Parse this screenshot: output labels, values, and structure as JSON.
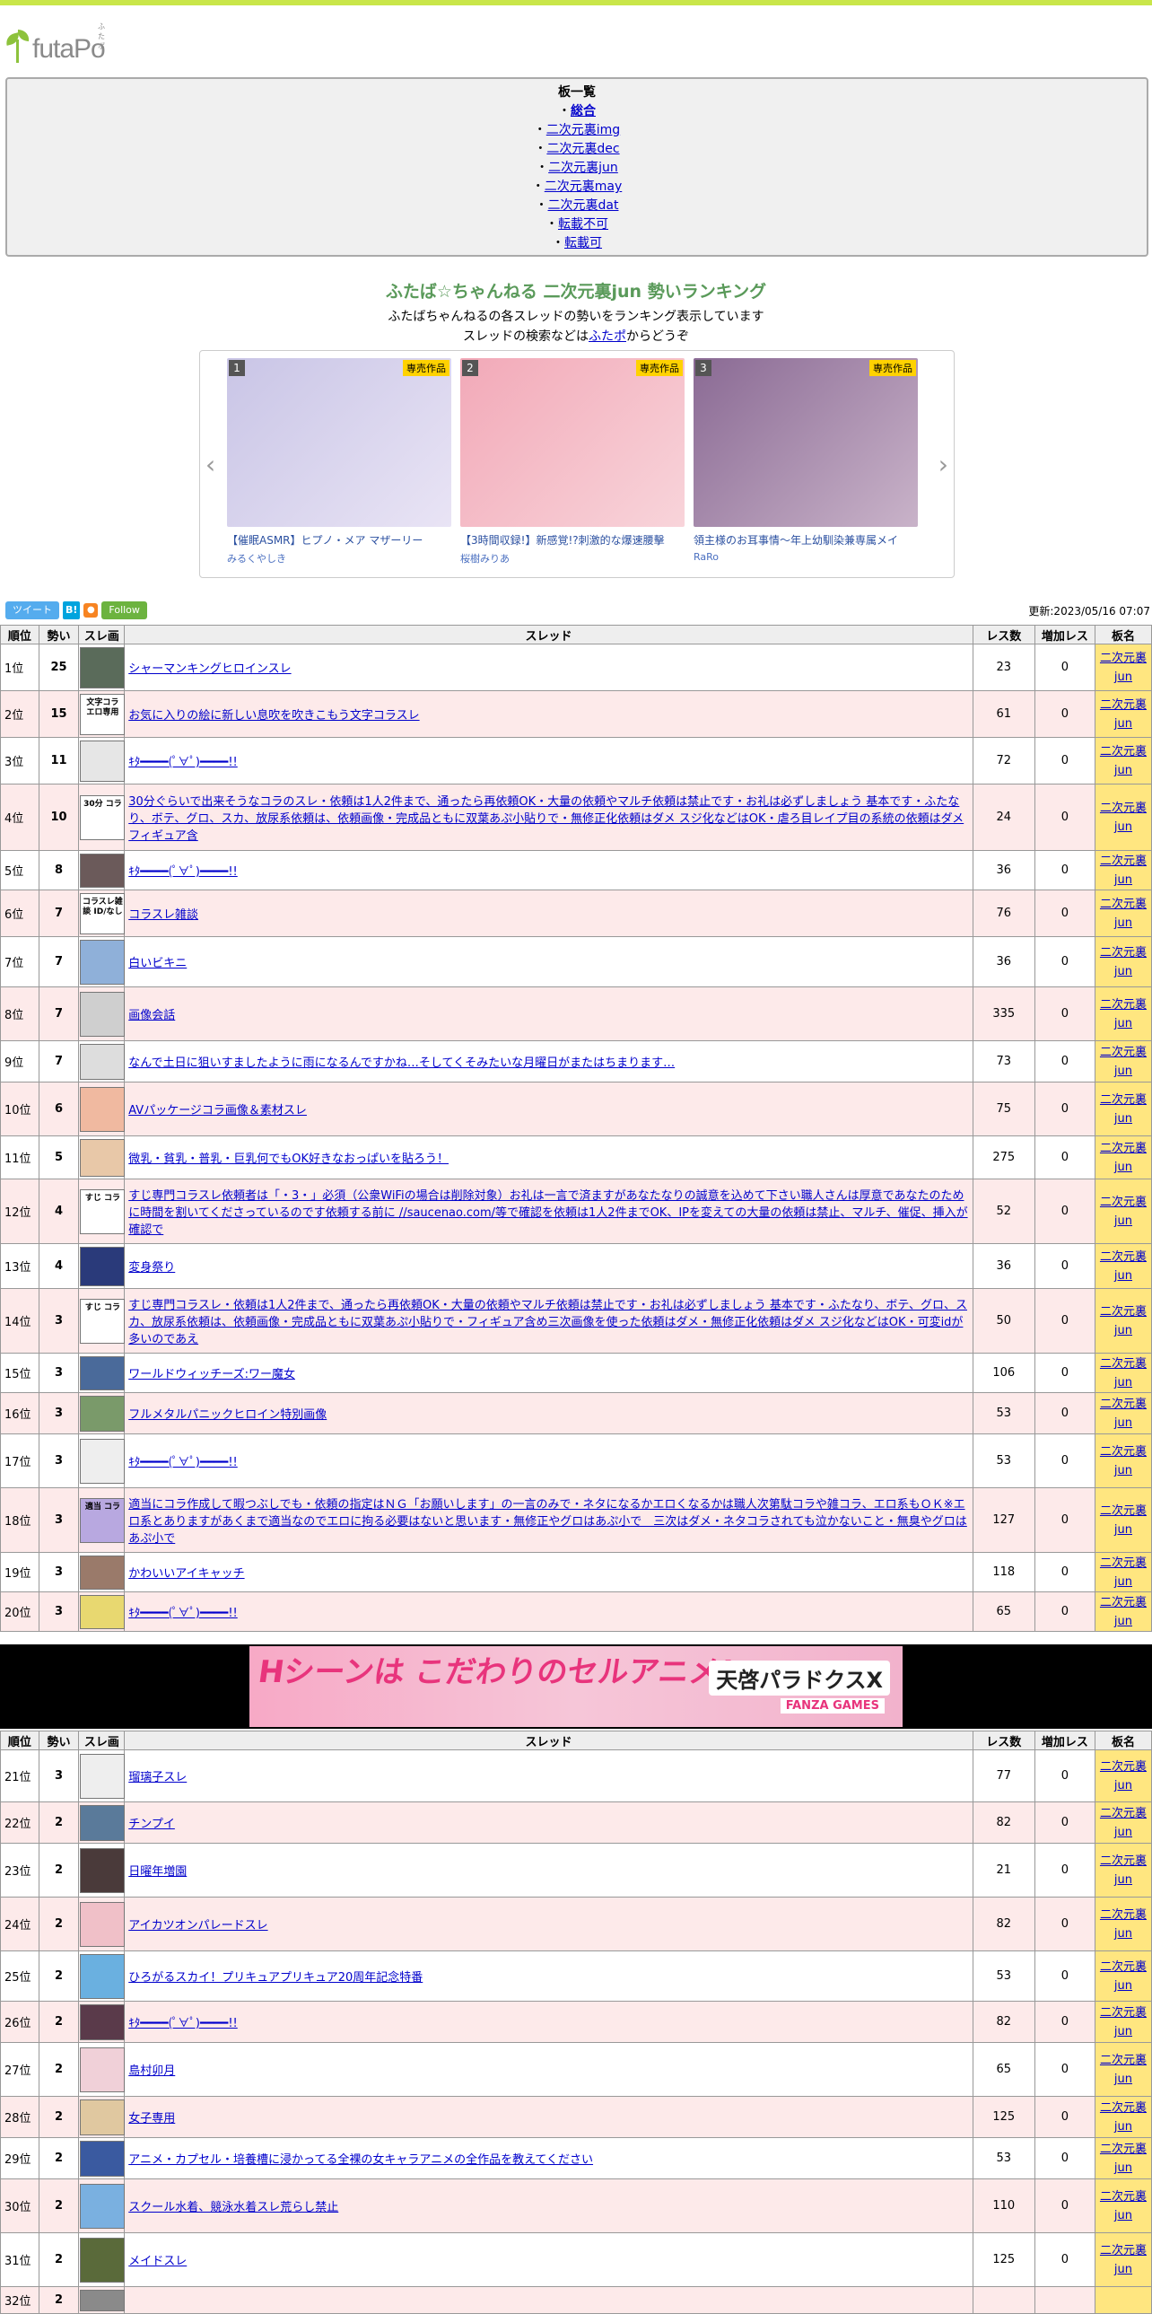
{
  "site": {
    "logo_text": "futaPo",
    "logo_ruby": "ふたポ"
  },
  "boards": {
    "heading": "板一覧",
    "items": [
      "総合",
      "二次元裏img",
      "二次元裏dec",
      "二次元裏jun",
      "二次元裏may",
      "二次元裏dat",
      "転載不可",
      "転載可"
    ]
  },
  "page": {
    "title": "ふたば☆ちゃんねる 二次元裏jun 勢いランキング",
    "desc1": "ふたばちゃんねるの各スレッドの勢いをランキング表示しています",
    "desc2_pre": "スレッドの検索などは",
    "desc2_link": "ふたポ",
    "desc2_post": "からどうぞ",
    "updated": "更新:2023/05/16 07:07"
  },
  "carousel": {
    "cards": [
      {
        "num": "1",
        "badge": "専売作品",
        "title": "【催眠ASMR】ヒプノ・メア マザーリー",
        "author": "みるくやしき",
        "color1": "#c9c5e6",
        "color2": "#e9e4f5"
      },
      {
        "num": "2",
        "badge": "専売作品",
        "title": "【3時間収録!】新感覚!?刺激的な爆速腰擊",
        "author": "桜樹みりあ",
        "color1": "#f2a9b8",
        "color2": "#f8d4da"
      },
      {
        "num": "3",
        "badge": "専売作品",
        "title": "領主様のお耳事情～年上幼馴染兼専属メイ",
        "author": "RaRo",
        "color1": "#8a6a94",
        "color2": "#c9b3c9"
      }
    ]
  },
  "social": {
    "tweet": "ツイート",
    "hatena": "B!",
    "rss": "RSS",
    "follow": "Follow"
  },
  "table": {
    "headers": [
      "順位",
      "勢い",
      "スレ画",
      "スレッド",
      "レス数",
      "増加レス",
      "板名"
    ],
    "board_line1": "二次元裏",
    "board_line2": "jun"
  },
  "rows_a": [
    {
      "rank": "1位",
      "mo": "25",
      "title": "シャーマンキングヒロインスレ",
      "res": "23",
      "inc": "0",
      "h": 52,
      "thumb": "#5a6b5a"
    },
    {
      "rank": "2位",
      "mo": "15",
      "title": "お気に入りの絵に新しい息吹を吹きこもう文字コラスレ",
      "res": "61",
      "inc": "0",
      "h": 52,
      "thumb": "#ffffff",
      "thumb_text": "文字コラ エロ専用"
    },
    {
      "rank": "3位",
      "mo": "11",
      "title": "ｷﾀ━━━━(ﾟ∀ﾟ)━━━━!!",
      "res": "72",
      "inc": "0",
      "h": 52,
      "thumb": "#e6e6e6"
    },
    {
      "rank": "4位",
      "mo": "10",
      "title": "30分ぐらいで出来そうなコラのスレ・依頼は1人2件まで、通ったら再依頼OK・大量の依頼やマルチ依頼は禁止です・お礼は必ずしましょう 基本です・ふたなり、ボテ、グロ、スカ、放尿系依頼は、依頼画像・完成品ともに双葉あぷ小貼りで・無修正化依頼はダメ スジ化などはOK・虐ろ目レイプ目の系統の依頼はダメ フィギュア含",
      "res": "24",
      "inc": "0",
      "h": 74,
      "thumb": "#ffffff",
      "thumb_text": "30分 コラ"
    },
    {
      "rank": "5位",
      "mo": "8",
      "title": "ｷﾀ━━━━(ﾟ∀ﾟ)━━━━!!",
      "res": "36",
      "inc": "0",
      "h": 44,
      "thumb": "#6b5a5a"
    },
    {
      "rank": "6位",
      "mo": "7",
      "title": "コラスレ雑談",
      "res": "76",
      "inc": "0",
      "h": 52,
      "thumb": "#ffffff",
      "thumb_text": "コラスレ雑談 ID/なし"
    },
    {
      "rank": "7位",
      "mo": "7",
      "title": "白いビキニ",
      "res": "36",
      "inc": "0",
      "h": 56,
      "thumb": "#8fb0d9"
    },
    {
      "rank": "8位",
      "mo": "7",
      "title": "画像会話",
      "res": "335",
      "inc": "0",
      "h": 60,
      "thumb": "#cfcfcf"
    },
    {
      "rank": "9位",
      "mo": "7",
      "title": "なんで土日に狙いすましたように雨になるんですかね…そしてくそみたいな月曜日がまたはちまります…",
      "res": "73",
      "inc": "0",
      "h": 46,
      "thumb": "#dddddd"
    },
    {
      "rank": "10位",
      "mo": "6",
      "title": "AVパッケージコラ画像＆素材スレ",
      "res": "75",
      "inc": "0",
      "h": 60,
      "thumb": "#f0b9a0"
    },
    {
      "rank": "11位",
      "mo": "5",
      "title": "微乳・貧乳・普乳・巨乳何でもOK好きなおっぱいを貼ろう！",
      "res": "275",
      "inc": "0",
      "h": 48,
      "thumb": "#e8c8a8"
    },
    {
      "rank": "12位",
      "mo": "4",
      "title": "すじ専門コラスレ依頼者は「・3・」必須（公衆WiFiの場合は削除対象）お礼は一言で済ますがあなたなりの誠意を込めて下さい職人さんは厚意であなたのために時間を割いてくださっているのです依頼する前に //saucenao.com/等で確認を依頼は1人2件までOK、IPを変えての大量の依頼は禁止、マルチ、催促、挿入が確認で",
      "res": "52",
      "inc": "0",
      "h": 72,
      "thumb": "#ffffff",
      "thumb_text": "すじ コラ"
    },
    {
      "rank": "13位",
      "mo": "4",
      "title": "変身祭り",
      "res": "36",
      "inc": "0",
      "h": 50,
      "thumb": "#2a3a7a"
    },
    {
      "rank": "14位",
      "mo": "3",
      "title": "すじ専門コラスレ・依頼は1人2件まで、通ったら再依頼OK・大量の依頼やマルチ依頼は禁止です・お礼は必ずしましょう 基本です・ふたなり、ボテ、グロ、スカ、放尿系依頼は、依頼画像・完成品ともに双葉あぷ小貼りで・フィギュア含め三次画像を使った依頼はダメ・無修正化依頼はダメ スジ化などはOK・可変idが多いのであえ",
      "res": "50",
      "inc": "0",
      "h": 72,
      "thumb": "#ffffff",
      "thumb_text": "すじ コラ"
    },
    {
      "rank": "15位",
      "mo": "3",
      "title": "ワールドウィッチーズ:ワー魔女",
      "res": "106",
      "inc": "0",
      "h": 44,
      "thumb": "#4a6a9a"
    },
    {
      "rank": "16位",
      "mo": "3",
      "title": "フルメタルパニックヒロイン特別画像",
      "res": "53",
      "inc": "0",
      "h": 46,
      "thumb": "#7a9a6a"
    },
    {
      "rank": "17位",
      "mo": "3",
      "title": "ｷﾀ━━━━(ﾟ∀ﾟ)━━━━!!",
      "res": "53",
      "inc": "0",
      "h": 60,
      "thumb": "#eeeeee"
    },
    {
      "rank": "18位",
      "mo": "3",
      "title": "適当にコラ作成して暇つぶしでも・依頼の指定はＮＧ「お願いします」の一言のみで・ネタになるかエロくなるかは職人次第駄コラや雑コラ、エロ系もＯＫ※エロ系とありますがあくまで適当なのでエロに拘る必要はないと思います・無修正やグロはあぷ小で　三次はダメ・ネタコラされても泣かないこと・無臭やグロはあぷ小で",
      "res": "127",
      "inc": "0",
      "h": 72,
      "thumb": "#b8a8e0",
      "thumb_text": "適当 コラ"
    },
    {
      "rank": "19位",
      "mo": "3",
      "title": "かわいいアイキャッチ",
      "res": "118",
      "inc": "0",
      "h": 44,
      "thumb": "#9a7a6a"
    },
    {
      "rank": "20位",
      "mo": "3",
      "title": "ｷﾀ━━━━(ﾟ∀ﾟ)━━━━!!",
      "res": "65",
      "inc": "0",
      "h": 44,
      "thumb": "#e8d870"
    }
  ],
  "ad": {
    "left_text": "Hシーンは こだわりのセルアニメ!",
    "right_text": "天啓パラドクスX",
    "right_sub": "FANZA GAMES"
  },
  "rows_b": [
    {
      "rank": "21位",
      "mo": "3",
      "title": "瑠璃子スレ",
      "res": "77",
      "inc": "0",
      "h": 58,
      "thumb": "#eeeeee"
    },
    {
      "rank": "22位",
      "mo": "2",
      "title": "チンプイ",
      "res": "82",
      "inc": "0",
      "h": 46,
      "thumb": "#5a7a9a"
    },
    {
      "rank": "23位",
      "mo": "2",
      "title": "日曜年増園",
      "res": "21",
      "inc": "0",
      "h": 60,
      "thumb": "#4a3a3a"
    },
    {
      "rank": "24位",
      "mo": "2",
      "title": "アイカツオンパレードスレ",
      "res": "82",
      "inc": "0",
      "h": 60,
      "thumb": "#f0c0c8"
    },
    {
      "rank": "25位",
      "mo": "2",
      "title": "ひろがるスカイ！プリキュアプリキュア20周年記念特番",
      "res": "53",
      "inc": "0",
      "h": 56,
      "thumb": "#6ab0e0"
    },
    {
      "rank": "26位",
      "mo": "2",
      "title": "ｷﾀ━━━━(ﾟ∀ﾟ)━━━━!!",
      "res": "82",
      "inc": "0",
      "h": 46,
      "thumb": "#5a3a4a"
    },
    {
      "rank": "27位",
      "mo": "2",
      "title": "島村卯月",
      "res": "65",
      "inc": "0",
      "h": 60,
      "thumb": "#f0d0d8"
    },
    {
      "rank": "28位",
      "mo": "2",
      "title": "女子専用",
      "res": "125",
      "inc": "0",
      "h": 46,
      "thumb": "#e0c8a0"
    },
    {
      "rank": "29位",
      "mo": "2",
      "title": "アニメ・カプセル・培養槽に浸かってる全裸の女キャラアニメの全作品を教えてください",
      "res": "53",
      "inc": "0",
      "h": 46,
      "thumb": "#3a5aa0"
    },
    {
      "rank": "30位",
      "mo": "2",
      "title": "スクール水着、競泳水着スレ荒らし禁止",
      "res": "110",
      "inc": "0",
      "h": 60,
      "thumb": "#7ab0e0"
    },
    {
      "rank": "31位",
      "mo": "2",
      "title": "メイドスレ",
      "res": "125",
      "inc": "0",
      "h": 60,
      "thumb": "#5a6a3a"
    },
    {
      "rank": "32位",
      "mo": "2",
      "title": "",
      "res": "",
      "inc": "",
      "h": 30,
      "thumb": "#8a8a8a"
    }
  ]
}
